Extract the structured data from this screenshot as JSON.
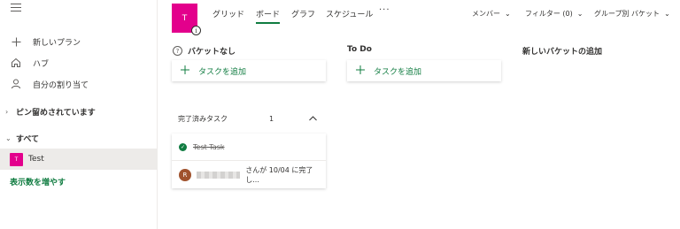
{
  "sidebar": {
    "items": [
      {
        "label": "新しいプラン",
        "icon": "plus-icon"
      },
      {
        "label": "ハブ",
        "icon": "home-icon"
      },
      {
        "label": "自分の割り当て",
        "icon": "person-icon"
      }
    ],
    "pinned_header": "ピン留めされています",
    "all_header": "すべて",
    "plans": [
      {
        "label": "Test",
        "avatar": "T"
      }
    ],
    "show_more": "表示数を増やす"
  },
  "header": {
    "plan_avatar": "T",
    "tabs": [
      {
        "label": "グリッド",
        "active": false
      },
      {
        "label": "ボード",
        "active": true
      },
      {
        "label": "グラフ",
        "active": false
      },
      {
        "label": "スケジュール",
        "active": false
      }
    ],
    "more": "···",
    "members": "メンバー",
    "filter": "フィルター (0)",
    "group_by": "グループ別 バケット"
  },
  "buckets": [
    {
      "title": "バケットなし",
      "add_label": "タスクを追加"
    },
    {
      "title": "To Do",
      "add_label": "タスクを追加"
    },
    {
      "title": "新しいバケットの追加"
    }
  ],
  "completed": {
    "label": "完了済みタスク",
    "count": "1",
    "task": {
      "name": "Test Task",
      "user_initial": "R",
      "completed_text": "さんが 10/04 に完了し..."
    }
  },
  "colors": {
    "accent": "#107c41",
    "plan": "#e3008c"
  }
}
